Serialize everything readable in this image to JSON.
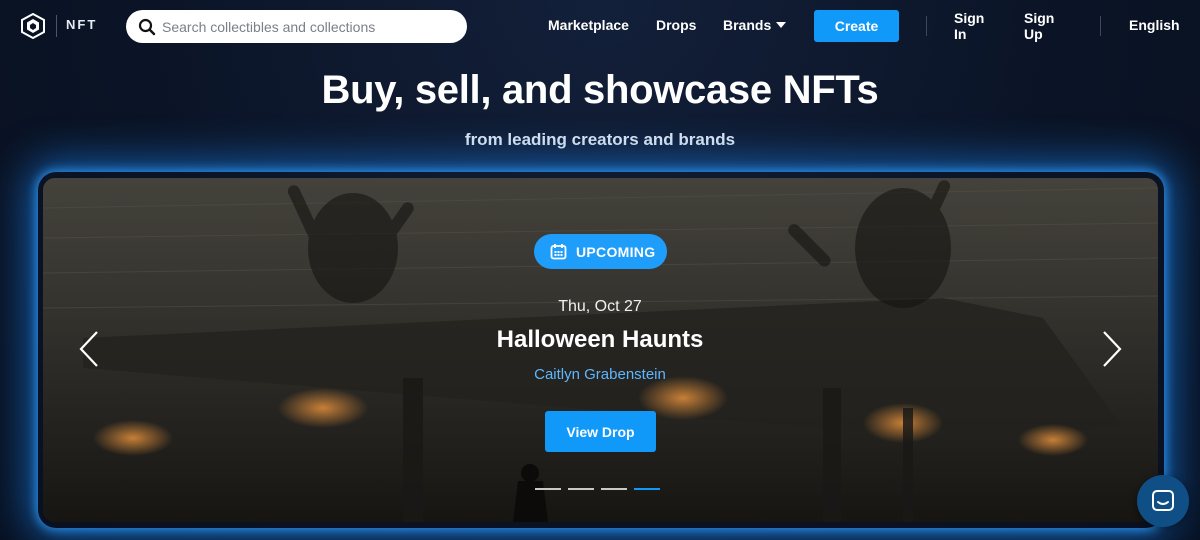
{
  "header": {
    "brand_text": "NFT",
    "logo_icon": "crypto-com-logo-icon",
    "search": {
      "placeholder": "Search collectibles and collections",
      "value": "",
      "icon": "search-icon"
    },
    "nav": {
      "marketplace": "Marketplace",
      "drops": "Drops",
      "brands": "Brands",
      "brands_icon": "caret-down-icon",
      "create": "Create",
      "sign_in": "Sign In",
      "sign_up": "Sign Up",
      "language": "English"
    }
  },
  "hero": {
    "title": "Buy, sell, and showcase NFTs",
    "subtitle": "from leading creators and brands"
  },
  "banner": {
    "badge": {
      "label": "UPCOMING",
      "icon": "calendar-icon"
    },
    "date": "Thu, Oct 27",
    "title": "Halloween Haunts",
    "creator": "Caitlyn Grabenstein",
    "cta": "View Drop",
    "prev_icon": "chevron-left-icon",
    "next_icon": "chevron-right-icon",
    "slides_total": 4,
    "active_slide": 4
  },
  "chat": {
    "icon": "chat-icon"
  },
  "colors": {
    "background": "#0b1426",
    "accent": "#1199fa",
    "creator_link": "#5db7ff",
    "glow": "#198cff"
  }
}
